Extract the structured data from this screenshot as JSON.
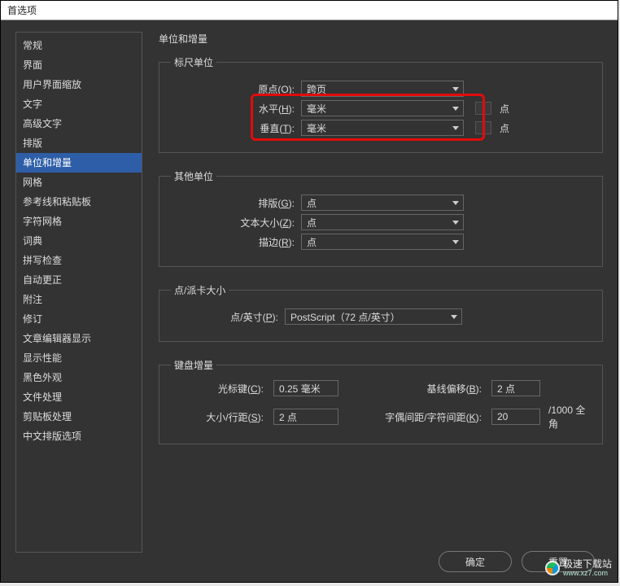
{
  "window": {
    "title": "首选项"
  },
  "sidebar": {
    "items": [
      {
        "label": "常规"
      },
      {
        "label": "界面"
      },
      {
        "label": "用户界面缩放"
      },
      {
        "label": "文字"
      },
      {
        "label": "高级文字"
      },
      {
        "label": "排版"
      },
      {
        "label": "单位和增量",
        "selected": true
      },
      {
        "label": "网格"
      },
      {
        "label": "参考线和粘贴板"
      },
      {
        "label": "字符网格"
      },
      {
        "label": "词典"
      },
      {
        "label": "拼写检查"
      },
      {
        "label": "自动更正"
      },
      {
        "label": "附注"
      },
      {
        "label": "修订"
      },
      {
        "label": "文章编辑器显示"
      },
      {
        "label": "显示性能"
      },
      {
        "label": "黑色外观"
      },
      {
        "label": "文件处理"
      },
      {
        "label": "剪贴板处理"
      },
      {
        "label": "中文排版选项"
      }
    ]
  },
  "main": {
    "heading": "单位和增量",
    "ruler": {
      "legend": "标尺单位",
      "origin": {
        "label_pre": "原点(",
        "key": "O",
        "label_post": "):",
        "value": "跨页"
      },
      "horizontal": {
        "label_pre": "水平(",
        "key": "H",
        "label_post": "):",
        "value": "毫米",
        "unit": "点"
      },
      "vertical": {
        "label_pre": "垂直(",
        "key": "T",
        "label_post": "):",
        "value": "毫米",
        "unit": "点"
      }
    },
    "other": {
      "legend": "其他单位",
      "typeset": {
        "label_pre": "排版(",
        "key": "G",
        "label_post": "):",
        "value": "点"
      },
      "textsize": {
        "label_pre": "文本大小(",
        "key": "Z",
        "label_post": "):",
        "value": "点"
      },
      "stroke": {
        "label_pre": "描边(",
        "key": "R",
        "label_post": "):",
        "value": "点"
      }
    },
    "pica": {
      "legend": "点/派卡大小",
      "ppi": {
        "label_pre": "点/英寸(",
        "key": "P",
        "label_post": "):",
        "value": "PostScript（72 点/英寸）"
      }
    },
    "keyboard": {
      "legend": "键盘增量",
      "cursor": {
        "label_pre": "光标键(",
        "key": "C",
        "label_post": "):",
        "value": "0.25 毫米"
      },
      "baseline": {
        "label_pre": "基线偏移(",
        "key": "B",
        "label_post": "):",
        "value": "2 点"
      },
      "sizeleading": {
        "label_pre": "大小/行距(",
        "key": "S",
        "label_post": "):",
        "value": "2 点"
      },
      "kerning": {
        "label_pre": "字偶间距/字符间距(",
        "key": "K",
        "label_post": "):",
        "value": "20",
        "suffix": "/1000 全角"
      }
    }
  },
  "footer": {
    "ok": "确定",
    "reset": "重置"
  },
  "watermark": {
    "line1": "极速下载站",
    "line2": "www.xz7.com"
  }
}
